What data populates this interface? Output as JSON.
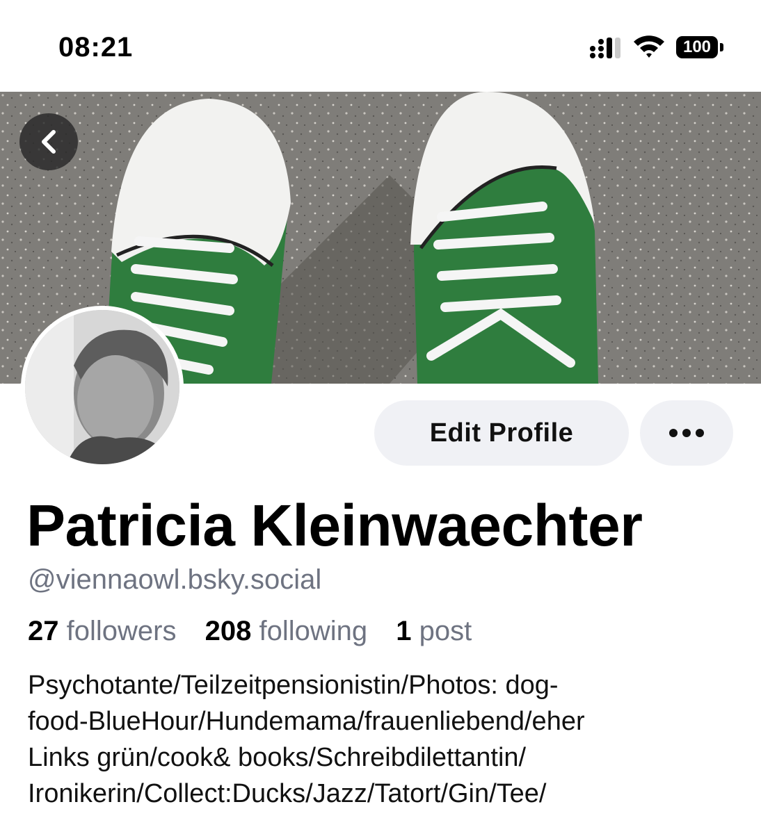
{
  "status_bar": {
    "time": "08:21",
    "battery": "100",
    "icons": [
      "signal-icon",
      "wifi-icon",
      "battery-icon"
    ]
  },
  "header": {
    "back_icon": "chevron-left-icon"
  },
  "profile": {
    "display_name": "Patricia Kleinwaechter",
    "handle": "@viennaowl.bsky.social",
    "edit_profile_label": "Edit Profile",
    "more_icon": "ellipsis-icon",
    "stats": {
      "followers_count": "27",
      "followers_label": "followers",
      "following_count": "208",
      "following_label": "following",
      "posts_count": "1",
      "posts_label": "post"
    },
    "bio_lines": [
      "Psychotante/Teilzeitpensionistin/Photos: dog-",
      "food-BlueHour/Hundemama/frauenliebend/eher",
      "Links grün/cook& books/Schreibdilettantin/",
      "Ironikerin/Collect:Ducks/Jazz/Tatort/Gin/Tee/"
    ]
  },
  "colors": {
    "secondary_text": "#6e7381",
    "button_bg": "#f0f1f5",
    "shoe_green": "#2f7d3e"
  }
}
